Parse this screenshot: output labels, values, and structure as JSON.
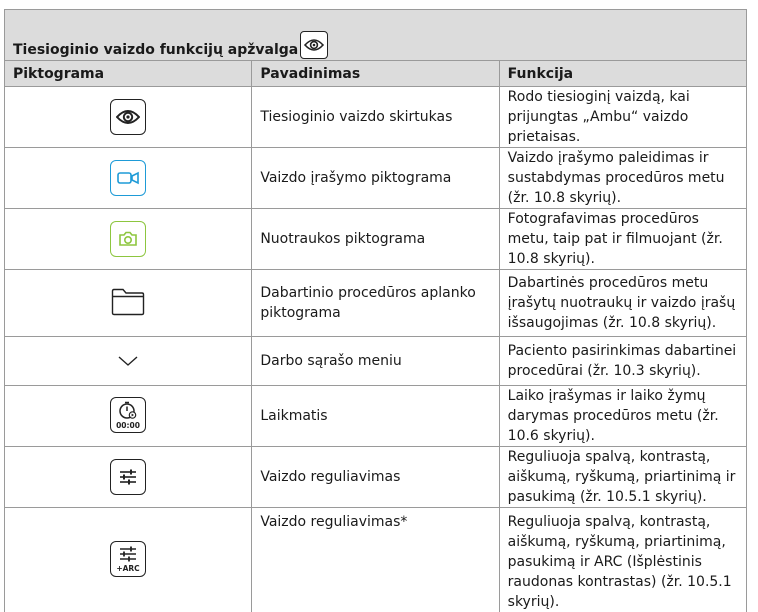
{
  "top_fragment": "",
  "table": {
    "caption": "Tiesioginio vaizdo funkcijų apžvalga",
    "caption_icon": "eye-icon",
    "headers": [
      "Piktograma",
      "Pavadinimas",
      "Funkcija"
    ],
    "rows": [
      {
        "icon": "eye-icon",
        "name": "Tiesioginio vaizdo skirtukas",
        "function": "Rodo tiesioginį vaizdą, kai prijungtas „Ambu“ vaizdo prietaisas."
      },
      {
        "icon": "video-camera-icon",
        "name": "Vaizdo įrašymo piktograma",
        "function": "Vaizdo įrašymo paleidimas ir sustabdymas procedūros metu (žr. 10.8 skyrių)."
      },
      {
        "icon": "camera-icon",
        "name": "Nuotraukos piktograma",
        "function": "Fotografavimas procedūros metu, taip pat ir filmuojant (žr. 10.8 skyrių)."
      },
      {
        "icon": "folder-icon",
        "name": "Dabartinio procedūros aplanko piktograma",
        "function": "Dabartinės procedūros metu įrašytų nuotraukų ir vaizdo įrašų išsaugojimas (žr. 10.8 skyrių)."
      },
      {
        "icon": "chevron-down-icon",
        "name": "Darbo sąrašo meniu",
        "function": "Paciento pasirinkimas dabartinei procedūrai (žr. 10.3 skyrių)."
      },
      {
        "icon": "timer-icon",
        "icon_text": "00:00",
        "name": "Laikmatis",
        "function": "Laiko įrašymas ir laiko žymų darymas procedūros metu (žr. 10.6 skyrių)."
      },
      {
        "icon": "sliders-icon",
        "name": "Vaizdo reguliavimas",
        "function": "Reguliuoja spalvą, kontrastą, aiškumą, ryškumą, priartinimą ir pasukimą (žr. 10.5.1 skyrių)."
      },
      {
        "icon": "sliders-arc-icon",
        "icon_text": "+ARC",
        "name": "Vaizdo reguliavimas*",
        "function": "Reguliuoja spalvą, kontrastą, aiškumą, ryškumą, priartinimą, pasukimą ir ARC (Išplėstinis raudonas kontrastas) (žr. 10.5.1 skyrių)."
      }
    ]
  },
  "colors": {
    "header_bg": "#dcdcdc",
    "border": "#9a9a9a",
    "video_icon": "#1e9bd7",
    "photo_icon": "#8dc63f"
  }
}
